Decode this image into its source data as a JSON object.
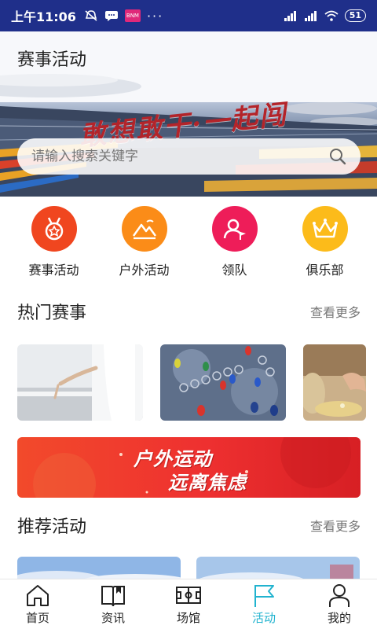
{
  "status_bar": {
    "time": "上午11:06",
    "app_badge": "BNM",
    "more": "···",
    "battery": "51"
  },
  "header": {
    "title": "赛事活动",
    "slogan": "敢想敢干·一起闯"
  },
  "search": {
    "placeholder": "请输入搜索关键字"
  },
  "categories": [
    {
      "label": "赛事活动",
      "color": "#f0461f",
      "icon": "medal-icon"
    },
    {
      "label": "户外活动",
      "color": "#fb8c18",
      "icon": "mountain-icon"
    },
    {
      "label": "领队",
      "color": "#ee1d59",
      "icon": "leader-icon"
    },
    {
      "label": "俱乐部",
      "color": "#fcbb1a",
      "icon": "crown-icon"
    }
  ],
  "hot": {
    "title": "热门赛事",
    "more": "查看更多"
  },
  "promo": {
    "line1": "户外运动",
    "line2": "远离焦虑"
  },
  "recommend": {
    "title": "推荐活动",
    "more": "查看更多"
  },
  "tabs": [
    {
      "label": "首页",
      "icon": "home-icon",
      "active": false
    },
    {
      "label": "资讯",
      "icon": "book-icon",
      "active": false
    },
    {
      "label": "场馆",
      "icon": "field-icon",
      "active": false
    },
    {
      "label": "活动",
      "icon": "flag-icon",
      "active": true
    },
    {
      "label": "我的",
      "icon": "person-icon",
      "active": false
    }
  ],
  "colors": {
    "status_bar": "#1f2f8a",
    "accent": "#21b3cf",
    "promo_red": "#ee3030"
  }
}
